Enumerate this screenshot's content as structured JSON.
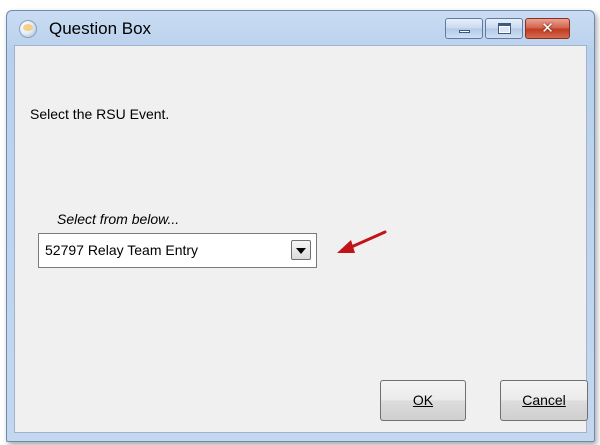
{
  "window": {
    "title": "Question Box",
    "controls": {
      "minimize": "minimize",
      "maximize": "maximize",
      "close": "✕"
    }
  },
  "main": {
    "prompt": "Select the RSU Event.",
    "select_label": "Select from below...",
    "dropdown": {
      "selected": "52797 Relay Team Entry"
    }
  },
  "buttons": {
    "ok_label": "OK",
    "cancel_label": "Cancel"
  },
  "colors": {
    "annotation_arrow": "#c0141a",
    "titlebar": "#c4d7ef",
    "close_button": "#c03b22"
  }
}
